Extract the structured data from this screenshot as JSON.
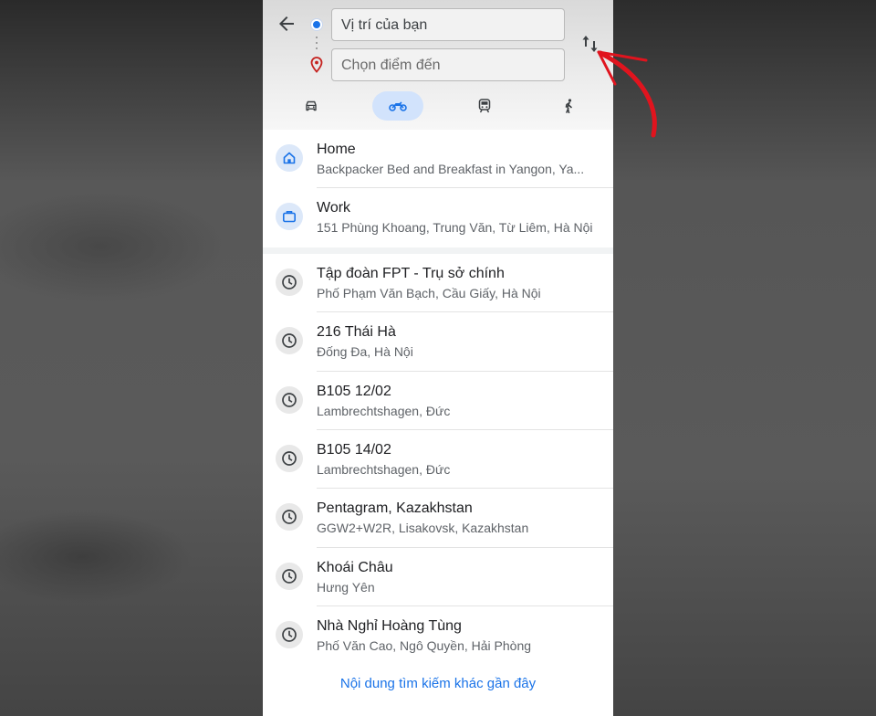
{
  "search": {
    "origin_value": "Vị trí của bạn",
    "destination_placeholder": "Chọn điểm đến"
  },
  "travel_modes": [
    {
      "name": "car",
      "icon": "car-icon",
      "selected": false
    },
    {
      "name": "motorbike",
      "icon": "motorcycle-icon",
      "selected": true
    },
    {
      "name": "transit",
      "icon": "train-icon",
      "selected": false
    },
    {
      "name": "walk",
      "icon": "walking-icon",
      "selected": false
    }
  ],
  "saved_places": [
    {
      "icon": "home-icon",
      "title": "Home",
      "subtitle": "Backpacker Bed and Breakfast in Yangon, Ya..."
    },
    {
      "icon": "briefcase-icon",
      "title": "Work",
      "subtitle": "151 Phùng Khoang, Trung Văn, Từ Liêm, Hà Nội"
    }
  ],
  "recent_places": [
    {
      "icon": "history-icon",
      "title": "Tập đoàn FPT - Trụ sở chính",
      "subtitle": "Phố Phạm Văn Bạch, Cầu Giấy, Hà Nội"
    },
    {
      "icon": "history-icon",
      "title": "216 Thái Hà",
      "subtitle": "Đống Đa, Hà Nội"
    },
    {
      "icon": "history-icon",
      "title": "B105 12/02",
      "subtitle": "Lambrechtshagen, Đức"
    },
    {
      "icon": "history-icon",
      "title": "B105 14/02",
      "subtitle": "Lambrechtshagen, Đức"
    },
    {
      "icon": "history-icon",
      "title": "Pentagram, Kazakhstan",
      "subtitle": "GGW2+W2R, Lisakovsk, Kazakhstan"
    },
    {
      "icon": "history-icon",
      "title": "Khoái Châu",
      "subtitle": "Hưng Yên"
    },
    {
      "icon": "history-icon",
      "title": "Nhà Nghỉ Hoàng Tùng",
      "subtitle": "Phố Văn Cao, Ngô Quyền, Hải Phòng"
    }
  ],
  "more_link": "Nội dung tìm kiếm khác gần đây",
  "colors": {
    "accent": "#1a73e8",
    "selected_mode_bg": "#d2e3fc",
    "annotation_arrow": "#e0141e",
    "pin": "#c5221f"
  }
}
